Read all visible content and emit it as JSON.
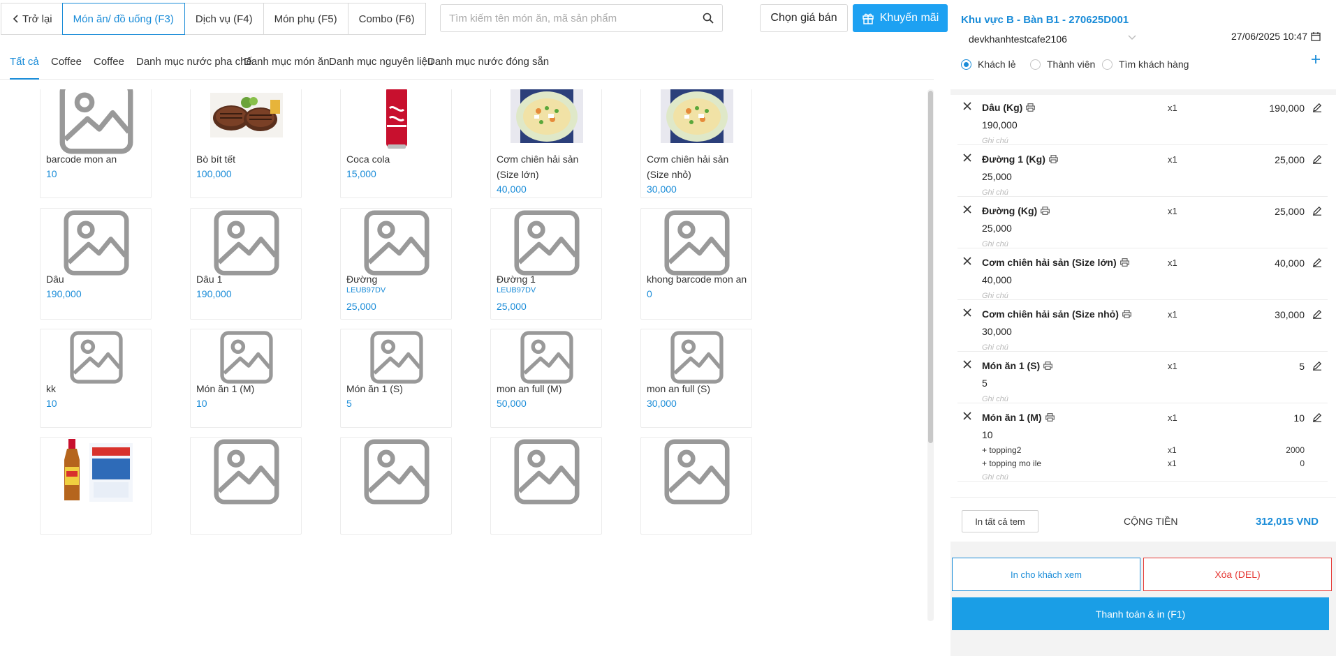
{
  "topbar": {
    "back_label": "Trở lại",
    "tabs": [
      "Món ăn/ đồ uống (F3)",
      "Dịch vụ (F4)",
      "Món phụ (F5)",
      "Combo (F6)"
    ],
    "search_placeholder": "Tìm kiếm tên món ăn, mã sản phẩm",
    "price_button": "Chọn giá bán",
    "promo_button": "Khuyến mãi"
  },
  "categories": [
    "Tất cả",
    "Coffee",
    "Coffee",
    "Danh mục nước pha chế",
    "Danh mục món ăn",
    "Danh mục nguyên liệu",
    "Danh mục nước đóng sẵn"
  ],
  "products": [
    {
      "name": "barcode mon an",
      "code": "",
      "price": "10",
      "image": "placeholder-image"
    },
    {
      "name": "Bò bít tết",
      "code": "",
      "price": "100,000",
      "image": "steak-photo"
    },
    {
      "name": "Coca cola",
      "code": "",
      "price": "15,000",
      "image": "coca-cola-can-photo"
    },
    {
      "name": "Cơm chiên hải sản (Size lớn)",
      "code": "",
      "price": "40,000",
      "image": "fried-rice-photo"
    },
    {
      "name": "Cơm chiên hải sản (Size nhỏ)",
      "code": "",
      "price": "30,000",
      "image": "fried-rice-photo"
    },
    {
      "name": "Dâu",
      "code": "",
      "price": "190,000",
      "image": "placeholder-image"
    },
    {
      "name": "Dâu 1",
      "code": "",
      "price": "190,000",
      "image": "placeholder-image"
    },
    {
      "name": "Đường",
      "code": "LEUB97DV",
      "price": "25,000",
      "image": "placeholder-image"
    },
    {
      "name": "Đường 1",
      "code": "LEUB97DV",
      "price": "25,000",
      "image": "placeholder-image"
    },
    {
      "name": "khong barcode mon an",
      "code": "",
      "price": "0",
      "image": "placeholder-image"
    },
    {
      "name": "kk",
      "code": "",
      "price": "10",
      "image": "placeholder-image"
    },
    {
      "name": "Món ăn 1 (M)",
      "code": "",
      "price": "10",
      "image": "placeholder-image"
    },
    {
      "name": "Món ăn 1 (S)",
      "code": "",
      "price": "5",
      "image": "placeholder-image"
    },
    {
      "name": "mon an full (M)",
      "code": "",
      "price": "50,000",
      "image": "placeholder-image"
    },
    {
      "name": "mon an full (S)",
      "code": "",
      "price": "30,000",
      "image": "placeholder-image"
    },
    {
      "name": "",
      "code": "",
      "price": "",
      "image": "fish-sauce-bottle-photo"
    },
    {
      "name": "",
      "code": "",
      "price": "",
      "image": "placeholder-image"
    },
    {
      "name": "",
      "code": "",
      "price": "",
      "image": "placeholder-image"
    },
    {
      "name": "",
      "code": "",
      "price": "",
      "image": "placeholder-image"
    },
    {
      "name": "",
      "code": "",
      "price": "",
      "image": "placeholder-image"
    }
  ],
  "order": {
    "title": "Khu vực B - Bàn B1 - 270625D001",
    "store": "devkhanhtestcafe2106",
    "datetime": "27/06/2025 10:47",
    "customer_types": [
      "Khách lẻ",
      "Thành viên",
      "Tìm khách hàng"
    ],
    "selected_customer_type": "Khách lẻ",
    "note_placeholder": "Ghi chú",
    "items": [
      {
        "name": "Dâu (Kg)",
        "qty": "x1",
        "total": "190,000",
        "unit_price": "190,000",
        "toppings": []
      },
      {
        "name": "Đường 1 (Kg)",
        "qty": "x1",
        "total": "25,000",
        "unit_price": "25,000",
        "toppings": []
      },
      {
        "name": "Đường (Kg)",
        "qty": "x1",
        "total": "25,000",
        "unit_price": "25,000",
        "toppings": []
      },
      {
        "name": "Cơm chiên hải sản (Size lớn)",
        "qty": "x1",
        "total": "40,000",
        "unit_price": "40,000",
        "toppings": []
      },
      {
        "name": "Cơm chiên hải sản (Size nhỏ)",
        "qty": "x1",
        "total": "30,000",
        "unit_price": "30,000",
        "toppings": []
      },
      {
        "name": "Món ăn 1 (S)",
        "qty": "x1",
        "total": "5",
        "unit_price": "5",
        "toppings": []
      },
      {
        "name": "Món ăn 1 (M)",
        "qty": "x1",
        "total": "10",
        "unit_price": "10",
        "toppings": [
          {
            "name": "+ topping2",
            "qty": "x1",
            "price": "2000"
          },
          {
            "name": "+ topping mo ile",
            "qty": "x1",
            "price": "0"
          }
        ]
      }
    ],
    "print_all_label": "In tất cả tem",
    "total_label": "CỘNG TIỀN",
    "total_value": "312,015 VND",
    "print_customer_label": "In cho khách xem",
    "delete_label": "Xóa (DEL)",
    "pay_label": "Thanh toán & in (F1)"
  },
  "colors": {
    "accent": "#1a8cd8",
    "primary_button": "#1da1f2",
    "danger": "#e53935"
  }
}
